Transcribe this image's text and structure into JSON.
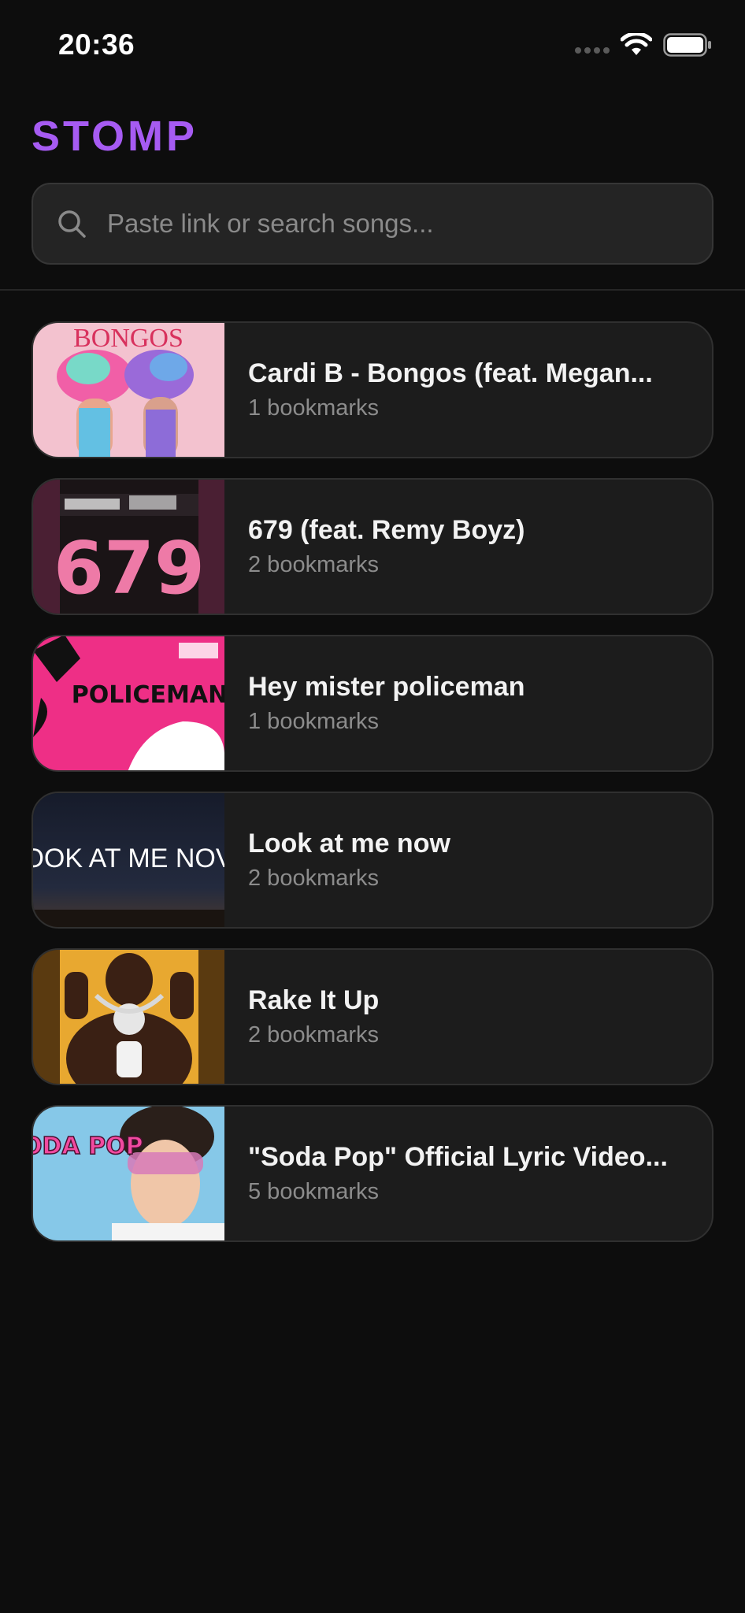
{
  "status_bar": {
    "time": "20:36",
    "icons": [
      "signal-icon",
      "wifi-icon",
      "battery-icon"
    ]
  },
  "app": {
    "title": "STOMP",
    "accent_color": "#a65bf2"
  },
  "search": {
    "placeholder": "Paste link or search songs...",
    "value": ""
  },
  "songs": [
    {
      "title": "Cardi B - Bongos (feat. Megan...",
      "bookmarks": "1 bookmarks",
      "artwork_text": "BONGOS"
    },
    {
      "title": "679 (feat. Remy Boyz)",
      "bookmarks": "2 bookmarks",
      "artwork_text": "679"
    },
    {
      "title": "Hey mister policeman",
      "bookmarks": "1 bookmarks",
      "artwork_text": "POLICEMAN"
    },
    {
      "title": "Look at me now",
      "bookmarks": "2 bookmarks",
      "artwork_text": "OOK AT ME NOV"
    },
    {
      "title": "Rake It Up",
      "bookmarks": "2 bookmarks",
      "artwork_text": ""
    },
    {
      "title": "\"Soda Pop\" Official Lyric Video...",
      "bookmarks": "5 bookmarks",
      "artwork_text": "SODA POP"
    }
  ]
}
